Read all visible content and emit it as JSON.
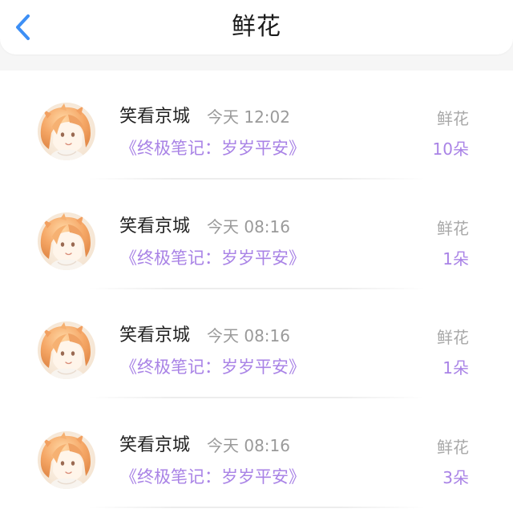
{
  "header": {
    "title": "鲜花",
    "back_icon": "chevron-left-icon",
    "accent_color": "#3d8ff5"
  },
  "colors": {
    "purple": "#a983e6",
    "gray": "#9a9a9a"
  },
  "records": [
    {
      "name": "笑看京城",
      "time": "今天 12:02",
      "book": "《终极笔记：岁岁平安》",
      "gift_type": "鲜花",
      "count": "10朵"
    },
    {
      "name": "笑看京城",
      "time": "今天 08:16",
      "book": "《终极笔记：岁岁平安》",
      "gift_type": "鲜花",
      "count": "1朵"
    },
    {
      "name": "笑看京城",
      "time": "今天 08:16",
      "book": "《终极笔记：岁岁平安》",
      "gift_type": "鲜花",
      "count": "1朵"
    },
    {
      "name": "笑看京城",
      "time": "今天 08:16",
      "book": "《终极笔记：岁岁平安》",
      "gift_type": "鲜花",
      "count": "3朵"
    }
  ]
}
